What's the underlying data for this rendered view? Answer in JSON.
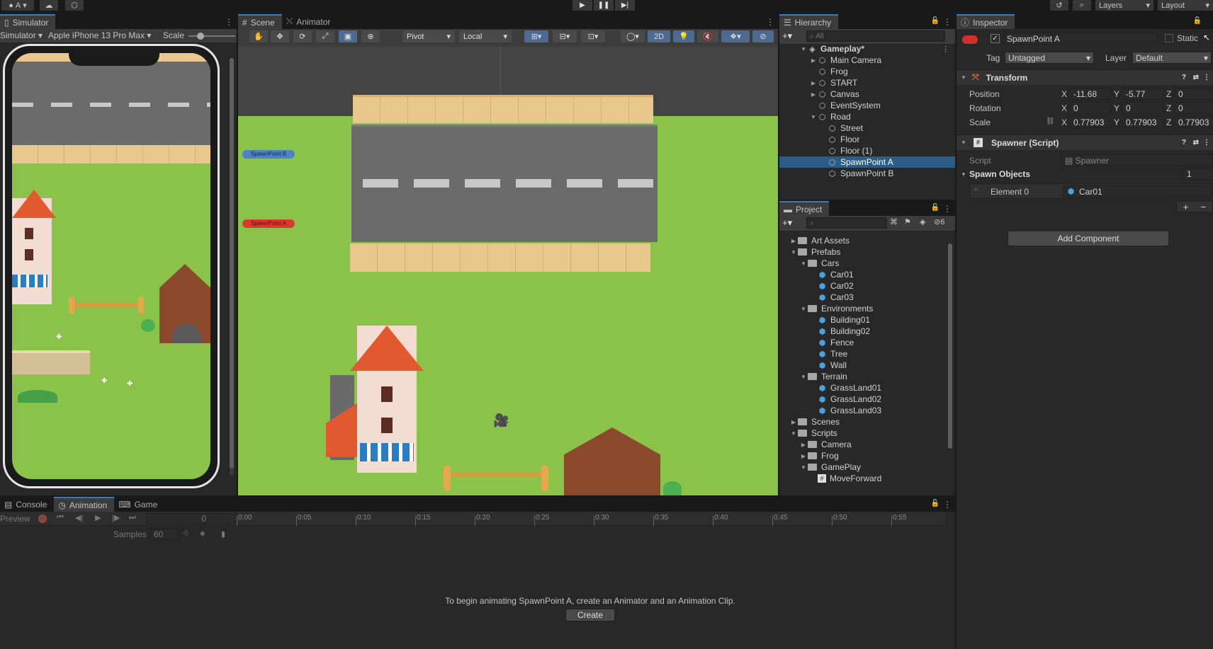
{
  "topbar": {
    "account_label": "A",
    "layers_label": "Layers",
    "layout_label": "Layout"
  },
  "simulator": {
    "tab_label": "Simulator",
    "mode_label": "Simulator",
    "device_label": "Apple iPhone 13 Pro Max",
    "scale_label": "Scale"
  },
  "scene": {
    "tab_label": "Scene",
    "animator_tab_label": "Animator",
    "pivot_label": "Pivot",
    "local_label": "Local",
    "mode_2d_label": "2D",
    "spawn_b_label": "SpawnPoint B",
    "spawn_a_label": "SpawnPoint A"
  },
  "hierarchy": {
    "tab_label": "Hierarchy",
    "search_placeholder": "All",
    "items": [
      {
        "label": "Gameplay*",
        "depth": 0,
        "arrow": "down",
        "icon": "unity-scene-icon"
      },
      {
        "label": "Main Camera",
        "depth": 1,
        "arrow": "right",
        "icon": "cube"
      },
      {
        "label": "Frog",
        "depth": 1,
        "arrow": "",
        "icon": "cube"
      },
      {
        "label": "START",
        "depth": 1,
        "arrow": "right",
        "icon": "cube"
      },
      {
        "label": "Canvas",
        "depth": 1,
        "arrow": "right",
        "icon": "cube"
      },
      {
        "label": "EventSystem",
        "depth": 1,
        "arrow": "",
        "icon": "cube"
      },
      {
        "label": "Road",
        "depth": 1,
        "arrow": "down",
        "icon": "cube"
      },
      {
        "label": "Street",
        "depth": 2,
        "arrow": "",
        "icon": "cube"
      },
      {
        "label": "Floor",
        "depth": 2,
        "arrow": "",
        "icon": "cube"
      },
      {
        "label": "Floor (1)",
        "depth": 2,
        "arrow": "",
        "icon": "cube"
      },
      {
        "label": "SpawnPoint A",
        "depth": 2,
        "arrow": "",
        "icon": "cube",
        "selected": true
      },
      {
        "label": "SpawnPoint B",
        "depth": 2,
        "arrow": "",
        "icon": "cube"
      }
    ]
  },
  "project": {
    "tab_label": "Project",
    "hidden_count": "6",
    "items": [
      {
        "label": "Art Assets",
        "depth": 0,
        "arrow": "right",
        "icon": "folder"
      },
      {
        "label": "Prefabs",
        "depth": 0,
        "arrow": "down",
        "icon": "folder"
      },
      {
        "label": "Cars",
        "depth": 1,
        "arrow": "down",
        "icon": "folder"
      },
      {
        "label": "Car01",
        "depth": 2,
        "arrow": "",
        "icon": "prefab"
      },
      {
        "label": "Car02",
        "depth": 2,
        "arrow": "",
        "icon": "prefab"
      },
      {
        "label": "Car03",
        "depth": 2,
        "arrow": "",
        "icon": "prefab"
      },
      {
        "label": "Environments",
        "depth": 1,
        "arrow": "down",
        "icon": "folder"
      },
      {
        "label": "Building01",
        "depth": 2,
        "arrow": "",
        "icon": "prefab"
      },
      {
        "label": "Building02",
        "depth": 2,
        "arrow": "",
        "icon": "prefab"
      },
      {
        "label": "Fence",
        "depth": 2,
        "arrow": "",
        "icon": "prefab"
      },
      {
        "label": "Tree",
        "depth": 2,
        "arrow": "",
        "icon": "prefab"
      },
      {
        "label": "Wall",
        "depth": 2,
        "arrow": "",
        "icon": "prefab"
      },
      {
        "label": "Terrain",
        "depth": 1,
        "arrow": "down",
        "icon": "folder"
      },
      {
        "label": "GrassLand01",
        "depth": 2,
        "arrow": "",
        "icon": "prefab"
      },
      {
        "label": "GrassLand02",
        "depth": 2,
        "arrow": "",
        "icon": "prefab"
      },
      {
        "label": "GrassLand03",
        "depth": 2,
        "arrow": "",
        "icon": "prefab"
      },
      {
        "label": "Scenes",
        "depth": 0,
        "arrow": "right",
        "icon": "folder"
      },
      {
        "label": "Scripts",
        "depth": 0,
        "arrow": "down",
        "icon": "folder"
      },
      {
        "label": "Camera",
        "depth": 1,
        "arrow": "right",
        "icon": "folder"
      },
      {
        "label": "Frog",
        "depth": 1,
        "arrow": "right",
        "icon": "folder"
      },
      {
        "label": "GamePlay",
        "depth": 1,
        "arrow": "down",
        "icon": "folder"
      },
      {
        "label": "MoveForward",
        "depth": 2,
        "arrow": "",
        "icon": "script"
      }
    ]
  },
  "inspector": {
    "tab_label": "Inspector",
    "object_name": "SpawnPoint A",
    "static_label": "Static",
    "tag_label": "Tag",
    "tag_value": "Untagged",
    "layer_label": "Layer",
    "layer_value": "Default",
    "transform": {
      "title": "Transform",
      "position_label": "Position",
      "rotation_label": "Rotation",
      "scale_label": "Scale",
      "x_label": "X",
      "y_label": "Y",
      "z_label": "Z",
      "position": {
        "x": "-11.68",
        "y": "-5.77",
        "z": "0"
      },
      "rotation": {
        "x": "0",
        "y": "0",
        "z": "0"
      },
      "scale": {
        "x": "0.77903",
        "y": "0.77903",
        "z": "0.77903"
      }
    },
    "spawner": {
      "title": "Spawner (Script)",
      "script_label": "Script",
      "script_value": "Spawner",
      "spawn_objects_label": "Spawn Objects",
      "spawn_objects_count": "1",
      "element_label": "Element 0",
      "element_value": "Car01"
    },
    "add_component_label": "Add Component"
  },
  "bottom": {
    "console_tab": "Console",
    "animation_tab": "Animation",
    "game_tab": "Game",
    "preview_label": "Preview",
    "frame_value": "0",
    "samples_label": "Samples",
    "samples_value": "60",
    "timeline_ticks": [
      "0:00",
      "0:05",
      "0:10",
      "0:15",
      "0:20",
      "0:25",
      "0:30",
      "0:35",
      "0:40",
      "0:45",
      "0:50",
      "0:55"
    ],
    "message": "To begin animating SpawnPoint A, create an Animator and an Animation Clip.",
    "create_label": "Create"
  },
  "colors": {
    "accent_blue": "#2c5d87",
    "grass": "#8bc34a",
    "road": "#6b6b6b",
    "sidewalk": "#e8c88c"
  }
}
